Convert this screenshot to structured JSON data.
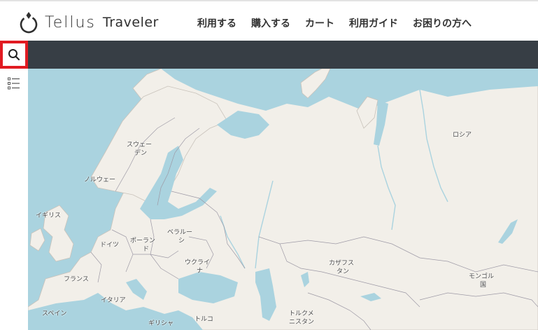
{
  "brand": {
    "logo_text": "Tellus",
    "product_name": "Traveler"
  },
  "nav": {
    "items": [
      {
        "label": "利用する"
      },
      {
        "label": "購入する"
      },
      {
        "label": "カート"
      },
      {
        "label": "利用ガイド"
      },
      {
        "label": "お困りの方へ"
      }
    ]
  },
  "sidebar": {
    "search_icon": "search-icon",
    "layers_icon": "list-icon",
    "highlight_color": "#e11b22"
  },
  "map": {
    "labels": {
      "russia": "ロシア",
      "sweden_1": "スウェー",
      "sweden_2": "デン",
      "norway": "ノルウェー",
      "uk": "イギリス",
      "belarus_1": "ベラルー",
      "belarus_2": "シ",
      "poland_1": "ポーラン",
      "poland_2": "ド",
      "germany": "ドイツ",
      "ukraine_1": "ウクライ",
      "ukraine_2": "ナ",
      "france": "フランス",
      "italy": "イタリア",
      "spain": "スペイン",
      "greece": "ギリシャ",
      "turkey": "トルコ",
      "kazakhstan_1": "カザフス",
      "kazakhstan_2": "タン",
      "turkmenistan_1": "トルクメ",
      "turkmenistan_2": "ニスタン",
      "mongolia_1": "モンゴル",
      "mongolia_2": "国"
    },
    "colors": {
      "water": "#aad3df",
      "land": "#f2efe9",
      "border": "#9e9aa6"
    }
  }
}
